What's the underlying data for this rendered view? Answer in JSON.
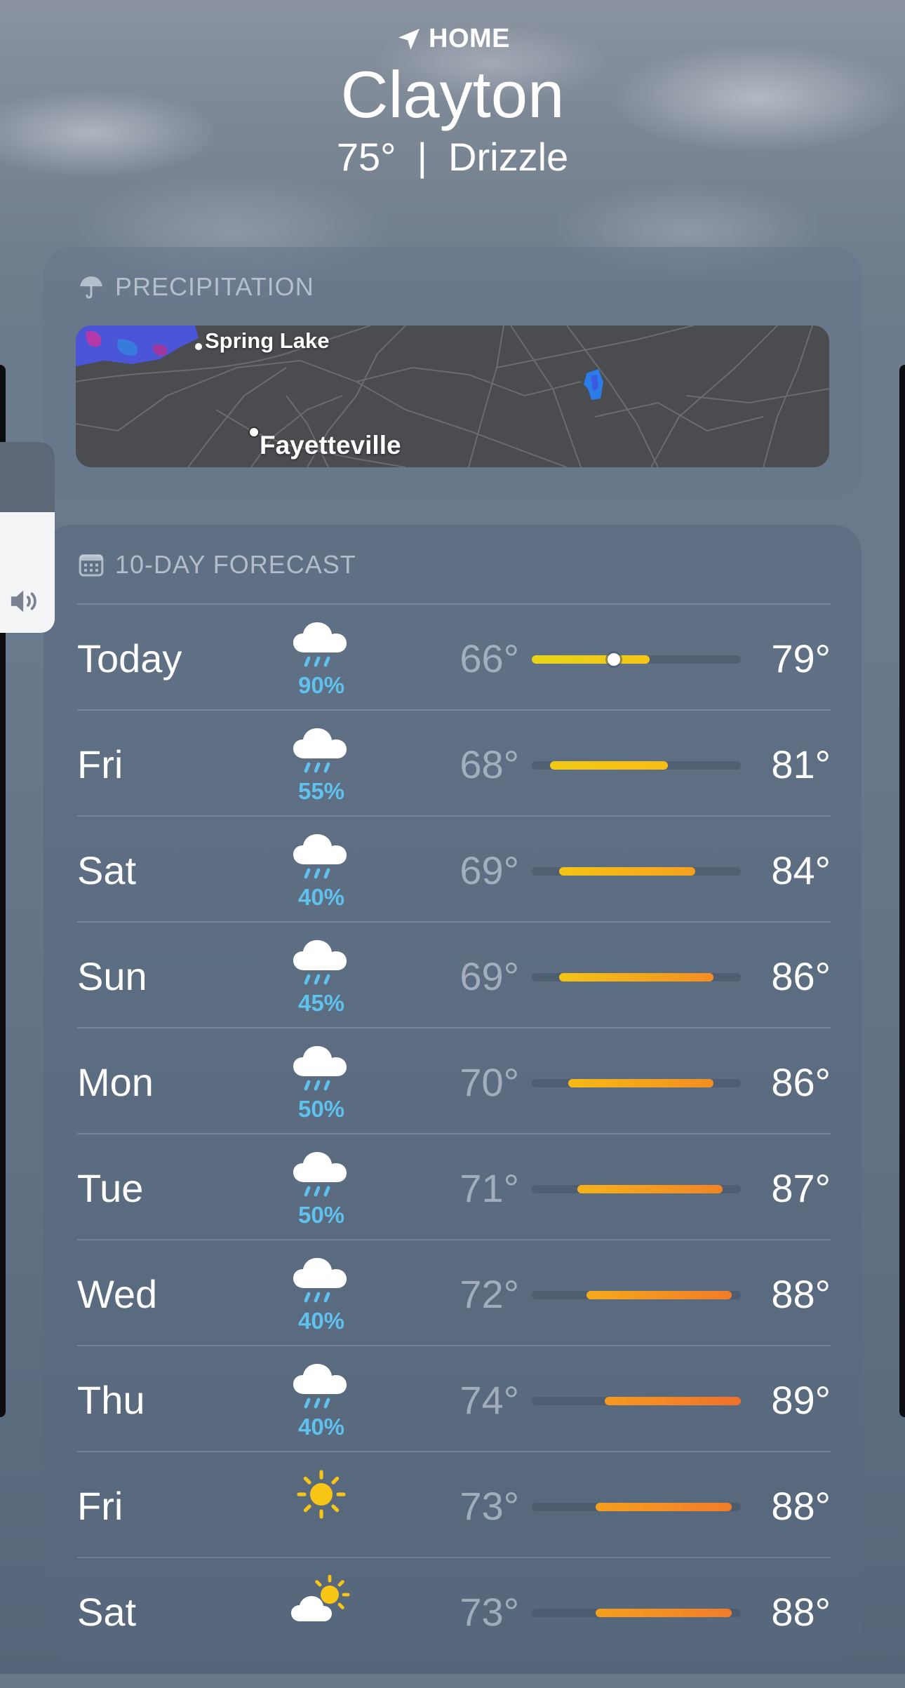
{
  "header": {
    "location_tag": "HOME",
    "city": "Clayton",
    "temperature": "75°",
    "separator": "|",
    "condition": "Drizzle"
  },
  "precipitation": {
    "title": "PRECIPITATION",
    "map_labels": {
      "spring_lake": "Spring Lake",
      "fayetteville": "Fayetteville"
    }
  },
  "forecast": {
    "title": "10-DAY FORECAST",
    "range_min": 66,
    "range_max": 89,
    "current_temp": 75,
    "days": [
      {
        "day": "Today",
        "icon": "cloud-rain-icon",
        "precip": "90%",
        "low": "66°",
        "high": "79°",
        "low_val": 66,
        "high_val": 79,
        "color_from": "#e6d41a",
        "color_to": "#f5c518",
        "show_current": true
      },
      {
        "day": "Fri",
        "icon": "cloud-rain-icon",
        "precip": "55%",
        "low": "68°",
        "high": "81°",
        "low_val": 68,
        "high_val": 81,
        "color_from": "#f2c915",
        "color_to": "#f7bd14"
      },
      {
        "day": "Sat",
        "icon": "cloud-rain-icon",
        "precip": "40%",
        "low": "69°",
        "high": "84°",
        "low_val": 69,
        "high_val": 84,
        "color_from": "#f5c414",
        "color_to": "#f6a01e"
      },
      {
        "day": "Sun",
        "icon": "cloud-rain-icon",
        "precip": "45%",
        "low": "69°",
        "high": "86°",
        "low_val": 69,
        "high_val": 86,
        "color_from": "#f5c414",
        "color_to": "#f48d22"
      },
      {
        "day": "Mon",
        "icon": "cloud-rain-icon",
        "precip": "50%",
        "low": "70°",
        "high": "86°",
        "low_val": 70,
        "high_val": 86,
        "color_from": "#f6bb16",
        "color_to": "#f48d22"
      },
      {
        "day": "Tue",
        "icon": "cloud-rain-icon",
        "precip": "50%",
        "low": "71°",
        "high": "87°",
        "low_val": 71,
        "high_val": 87,
        "color_from": "#f6b219",
        "color_to": "#f28426"
      },
      {
        "day": "Wed",
        "icon": "cloud-rain-icon",
        "precip": "40%",
        "low": "72°",
        "high": "88°",
        "low_val": 72,
        "high_val": 88,
        "color_from": "#f6a91b",
        "color_to": "#f17c29"
      },
      {
        "day": "Thu",
        "icon": "cloud-rain-icon",
        "precip": "40%",
        "low": "74°",
        "high": "89°",
        "low_val": 74,
        "high_val": 89,
        "color_from": "#f59a1f",
        "color_to": "#f0702c"
      },
      {
        "day": "Fri",
        "icon": "sun-icon",
        "precip": "",
        "low": "73°",
        "high": "88°",
        "low_val": 73,
        "high_val": 88,
        "color_from": "#f5a01e",
        "color_to": "#f17c29"
      },
      {
        "day": "Sat",
        "icon": "partly-sunny-icon",
        "precip": "",
        "low": "73°",
        "high": "88°",
        "low_val": 73,
        "high_val": 88,
        "color_from": "#f5a01e",
        "color_to": "#f17c29"
      }
    ]
  },
  "colors": {
    "precip_text": "#5ec1ee",
    "sun": "#f7c516"
  }
}
